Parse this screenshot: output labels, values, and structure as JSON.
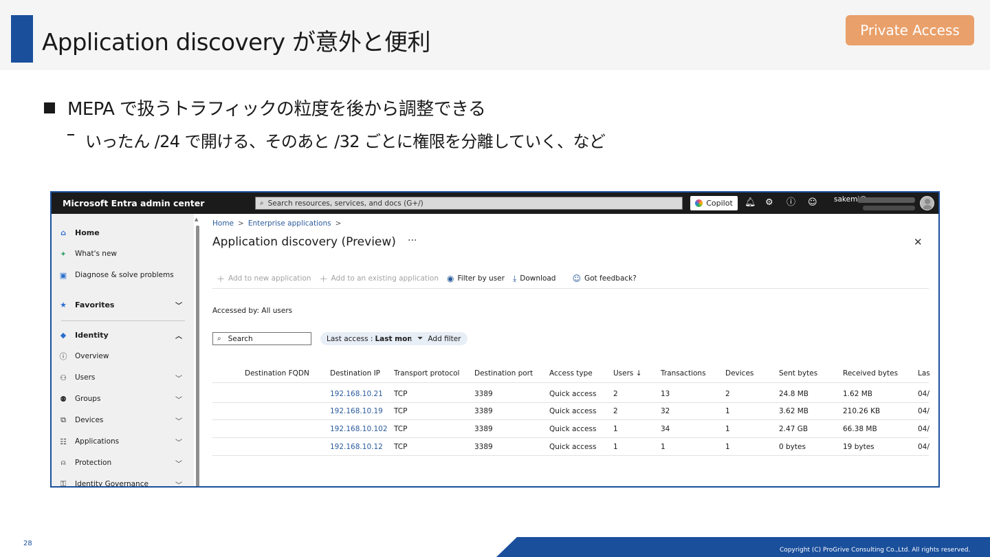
{
  "slide": {
    "title": "Application discovery が意外と便利",
    "tag": "Private Access",
    "bullet1": "MEPA で扱うトラフィックの粒度を後から調整できる",
    "bullet2": "いったん /24 で開ける、そのあと /32 ごとに権限を分離していく、など",
    "page_number": "28",
    "copyright": "Copyright (C) ProGrive Consulting Co.,Ltd. All rights reserved."
  },
  "portal": {
    "brand": "Microsoft Entra admin center",
    "search_placeholder": "Search resources, services, and docs (G+/)",
    "copilot_label": "Copilot",
    "user_name": "sakemi@",
    "topbar_icons": [
      "bell-icon",
      "gear-icon",
      "help-icon",
      "feedback-icon"
    ]
  },
  "sidebar": {
    "items": [
      {
        "label": "Home",
        "icon": "home-icon"
      },
      {
        "label": "What's new",
        "icon": "whats-new-icon"
      },
      {
        "label": "Diagnose & solve problems",
        "icon": "diagnose-icon"
      },
      {
        "label": "Favorites",
        "icon": "star-icon"
      },
      {
        "label": "Identity",
        "icon": "identity-icon"
      },
      {
        "label": "Overview",
        "icon": "info-icon"
      },
      {
        "label": "Users",
        "icon": "user-icon"
      },
      {
        "label": "Groups",
        "icon": "groups-icon"
      },
      {
        "label": "Devices",
        "icon": "devices-icon"
      },
      {
        "label": "Applications",
        "icon": "applications-icon"
      },
      {
        "label": "Protection",
        "icon": "protection-icon"
      },
      {
        "label": "Identity Governance",
        "icon": "governance-icon"
      }
    ]
  },
  "main": {
    "breadcrumb": [
      "Home",
      "Enterprise applications"
    ],
    "title": "Application discovery (Preview)",
    "toolbar": {
      "add_new": "Add to new application",
      "add_existing": "Add to an existing application",
      "filter_by_user": "Filter by user",
      "download": "Download",
      "feedback": "Got feedback?"
    },
    "accessed_by": "Accessed by: All users",
    "search_placeholder": "Search",
    "filter_pill_label": "Last access :",
    "filter_pill_value": "Last month",
    "add_filter": "Add filter"
  },
  "table": {
    "columns": [
      "Destination FQDN",
      "Destination IP",
      "Transport protocol",
      "Destination port",
      "Access type",
      "Users ↓",
      "Transactions",
      "Devices",
      "Sent bytes",
      "Received bytes",
      "Las"
    ],
    "rows": [
      {
        "fqdn": "",
        "ip": "192.168.10.21",
        "protocol": "TCP",
        "port": "3389",
        "access": "Quick access",
        "users": "2",
        "transactions": "13",
        "devices": "2",
        "sent": "24.8 MB",
        "received": "1.62 MB",
        "last": "04/"
      },
      {
        "fqdn": "",
        "ip": "192.168.10.19",
        "protocol": "TCP",
        "port": "3389",
        "access": "Quick access",
        "users": "2",
        "transactions": "32",
        "devices": "1",
        "sent": "3.62 MB",
        "received": "210.26 KB",
        "last": "04/"
      },
      {
        "fqdn": "",
        "ip": "192.168.10.102",
        "protocol": "TCP",
        "port": "3389",
        "access": "Quick access",
        "users": "1",
        "transactions": "34",
        "devices": "1",
        "sent": "2.47 GB",
        "received": "66.38 MB",
        "last": "04/"
      },
      {
        "fqdn": "",
        "ip": "192.168.10.12",
        "protocol": "TCP",
        "port": "3389",
        "access": "Quick access",
        "users": "1",
        "transactions": "1",
        "devices": "1",
        "sent": "0 bytes",
        "received": "19 bytes",
        "last": "04/"
      }
    ]
  },
  "colors": {
    "accent_blue": "#1a4f9c",
    "tag_orange": "#e9a06a",
    "link_blue": "#2a5b9c"
  }
}
